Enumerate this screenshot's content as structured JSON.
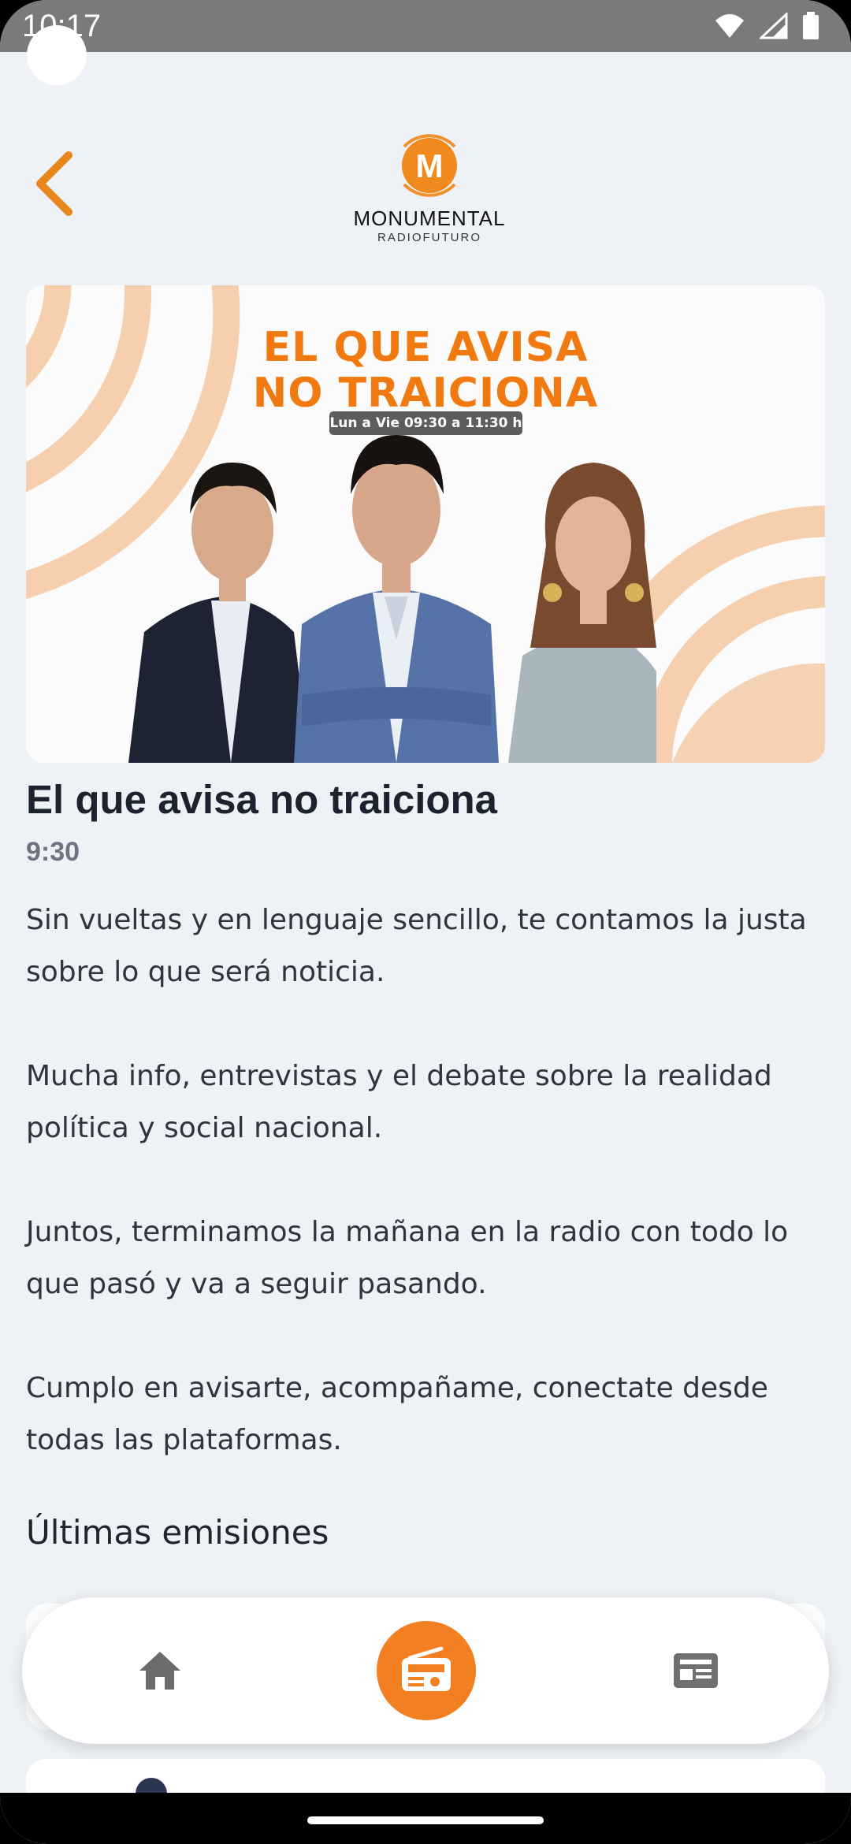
{
  "status_bar": {
    "time": "10:17",
    "icons": [
      "wifi-icon",
      "signal-icon",
      "battery-icon"
    ]
  },
  "header": {
    "back_icon": "chevron-left-icon",
    "logo": {
      "name": "MONUMENTAL",
      "subtitle": "RADIOFUTURO",
      "letter": "M"
    }
  },
  "banner": {
    "title_line1": "EL QUE AVISA",
    "title_line2": "NO TRAICIONA",
    "schedule": "Lun a Vie 09:30 a 11:30 h"
  },
  "show": {
    "title": "El que avisa no traiciona",
    "time": "9:30",
    "description": [
      "Sin vueltas y en lenguaje sencillo, te contamos la justa sobre lo que será noticia.",
      "Mucha info, entrevistas y el debate sobre la realidad política y social nacional.",
      "Juntos, terminamos la mañana en la radio con todo lo que pasó y va a seguir pasando.",
      "Cumplo en avisarte, acompañame, conectate desde todas las plataformas."
    ]
  },
  "section": {
    "latest_title": "Últimas emisiones"
  },
  "bottom_nav": {
    "items": [
      {
        "icon": "home-icon"
      },
      {
        "icon": "radio-icon",
        "active": true
      },
      {
        "icon": "news-icon"
      }
    ]
  },
  "colors": {
    "accent": "#f27f22",
    "banner_text": "#f07a10",
    "background": "#eef2f6",
    "title_text": "#1c2330",
    "muted_text": "#6d7584"
  }
}
